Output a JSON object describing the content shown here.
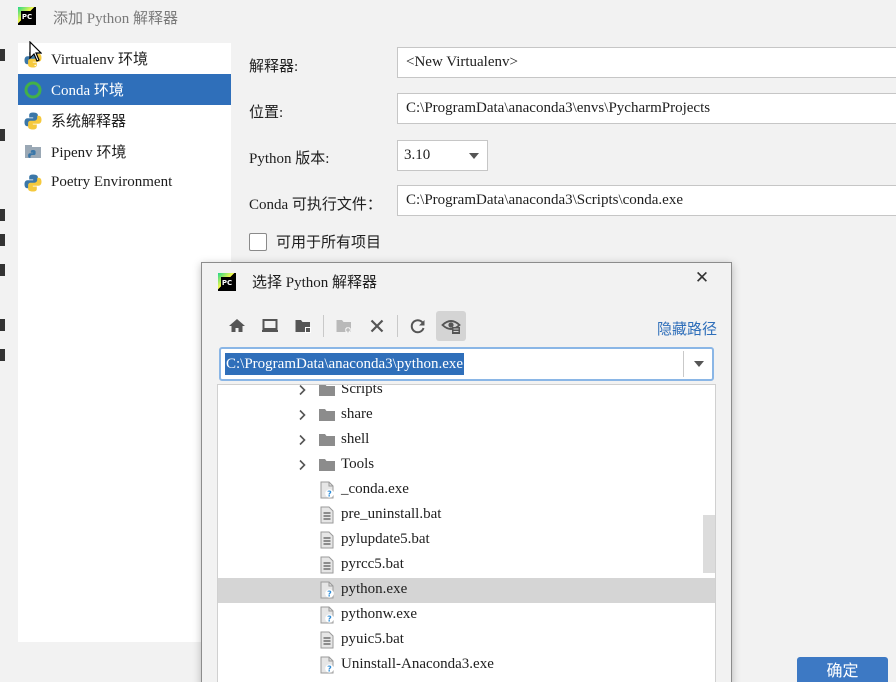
{
  "window": {
    "title": "添加 Python 解释器",
    "ok_label": "确定"
  },
  "sidebar": {
    "items": [
      {
        "label": "Virtualenv 环境",
        "icon": "python-icon"
      },
      {
        "label": "Conda 环境",
        "icon": "conda-icon",
        "active": true
      },
      {
        "label": "系统解释器",
        "icon": "python-icon"
      },
      {
        "label": "Pipenv 环境",
        "icon": "pipenv-icon"
      },
      {
        "label": "Poetry Environment",
        "icon": "python-icon"
      }
    ]
  },
  "form": {
    "interpreter_label": "解释器:",
    "interpreter_value": "<New Virtualenv>",
    "location_label": "位置:",
    "location_value": "C:\\ProgramData\\anaconda3\\envs\\PycharmProjects",
    "version_label": "Python 版本:",
    "version_value": "3.10",
    "conda_label": "Conda 可执行文件：",
    "conda_value": "C:\\ProgramData\\anaconda3\\Scripts\\conda.exe",
    "all_projects_label": "可用于所有项目",
    "all_projects_checked": false
  },
  "dialog": {
    "title": "选择 Python 解释器",
    "hide_path_label": "隐藏路径",
    "path_value": "C:\\ProgramData\\anaconda3\\python.exe",
    "toolbar": [
      "home-icon",
      "desktop-icon",
      "project-folder-icon",
      "new-folder-icon",
      "delete-icon",
      "refresh-icon",
      "show-hidden-icon"
    ],
    "tree": [
      {
        "name": "Scripts",
        "type": "folder"
      },
      {
        "name": "share",
        "type": "folder"
      },
      {
        "name": "shell",
        "type": "folder"
      },
      {
        "name": "Tools",
        "type": "folder"
      },
      {
        "name": "_conda.exe",
        "type": "exe"
      },
      {
        "name": "pre_uninstall.bat",
        "type": "bat"
      },
      {
        "name": "pylupdate5.bat",
        "type": "bat"
      },
      {
        "name": "pyrcc5.bat",
        "type": "bat"
      },
      {
        "name": "python.exe",
        "type": "exe",
        "selected": true
      },
      {
        "name": "pythonw.exe",
        "type": "exe"
      },
      {
        "name": "pyuic5.bat",
        "type": "bat"
      },
      {
        "name": "Uninstall-Anaconda3.exe",
        "type": "exe"
      }
    ]
  },
  "colors": {
    "accent": "#2f6fba",
    "selection": "#d5d5d5",
    "ok_button": "#3d79c4"
  }
}
